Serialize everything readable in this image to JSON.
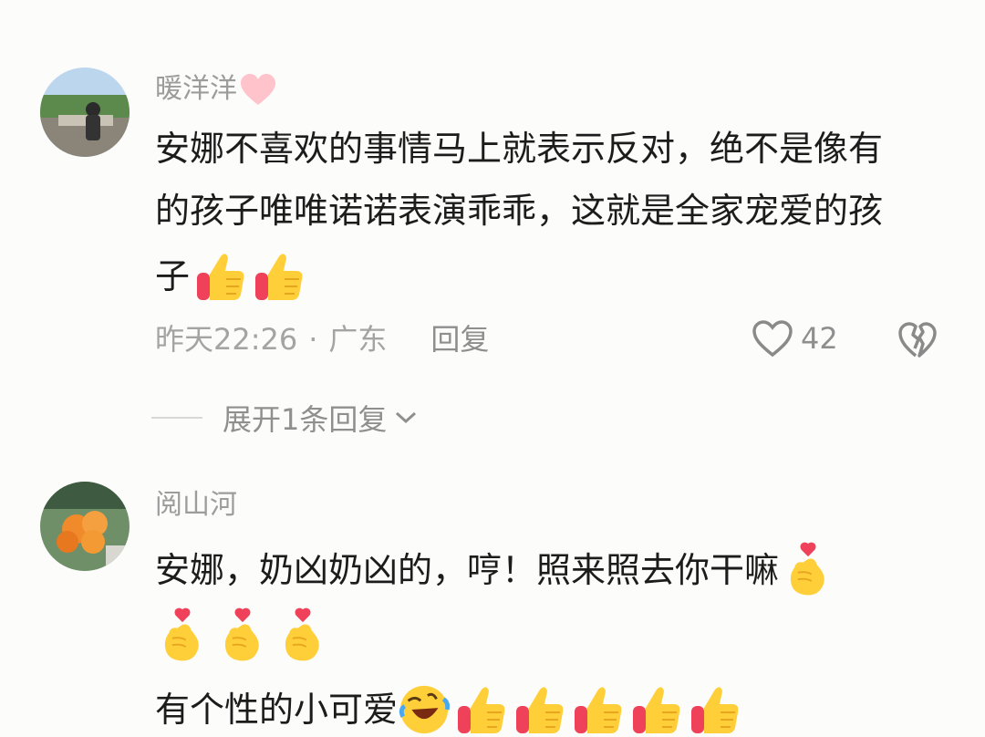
{
  "comments": [
    {
      "username": "暖洋洋",
      "username_icon": "pink-heart-icon",
      "lines": [
        "安娜不喜欢的事情马上就表示反对，绝不是像有",
        "的孩子唯唯诺诺表演乖乖，这就是全家宠爱的孩",
        "子"
      ],
      "line3_emojis": [
        "thumbs-up-icon",
        "thumbs-up-icon"
      ],
      "time": "昨天22:26",
      "separator": "·",
      "location": "广东",
      "reply_label": "回复",
      "likes": "42",
      "expand_label": "展开1条回复"
    },
    {
      "username": "阅山河",
      "lines": [
        "安娜，奶凶奶凶的，哼！照来照去你干嘛",
        "有个性的小可爱"
      ],
      "line1_emojis": [
        "finger-heart-icon"
      ],
      "line2_emojis": [
        "finger-heart-icon",
        "finger-heart-icon",
        "finger-heart-icon"
      ],
      "line3_emojis": [
        "rolling-laughing-icon",
        "thumbs-up-icon",
        "thumbs-up-icon",
        "thumbs-up-icon",
        "thumbs-up-icon",
        "thumbs-up-icon"
      ]
    }
  ],
  "colors": {
    "background": "#fcfcfb",
    "username": "#9c9c9c",
    "body_text": "#1c1c1c",
    "meta_text": "#a4a4a4",
    "thumb_yellow": "#ffcf3a",
    "thumb_red": "#f0415a",
    "heart_pink": "#ff9fb0"
  }
}
